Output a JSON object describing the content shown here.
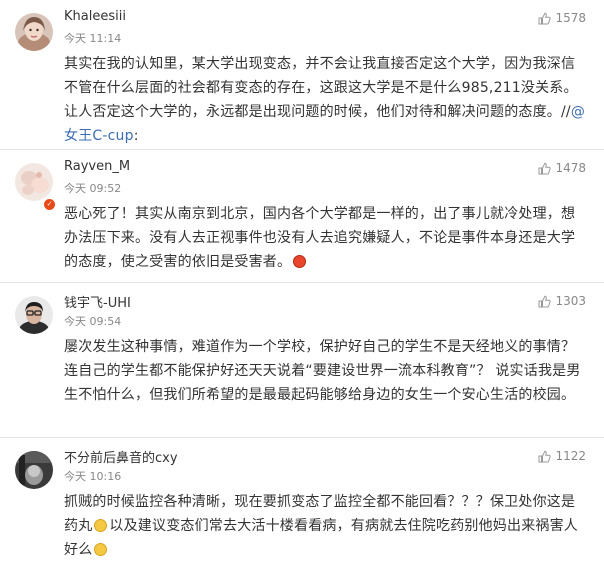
{
  "icons": {
    "like": "thumbs-up-icon",
    "smile": "smile-emoji-icon",
    "angry": "angry-emoji-icon",
    "badge": "verified-badge-icon"
  },
  "colors": {
    "mention": "#3c6cb4",
    "meta": "#888888",
    "text": "#333333",
    "divider": "#e3e3e3"
  },
  "comments": [
    {
      "username": "Khaleesiii",
      "time": "今天 11:14",
      "likes": "1578",
      "text_main": "其实在我的认知里，某大学出现变态，并不会让我直接否定这个大学，因为我深信不管在什么层面的社会都有变态的存在，这跟这大学是不是什么985,211没关系。让人否定这个大学的，永远都是出现问题的时候，他们对待和解决问题的态度。//",
      "mention": "@女王C-cup",
      "text_tail": ":"
    },
    {
      "username": "Rayven_M",
      "time": "今天 09:52",
      "likes": "1478",
      "text_main": "恶心死了！其实从南京到北京，国内各个大学都是一样的，出了事儿就冷处理，想办法压下来。没有人去正视事件也没有人去追究嫌疑人，不论是事件本身还是大学的态度，使之受害的依旧是受害者。"
    },
    {
      "username": "钱宇飞-UHI",
      "time": "今天 09:54",
      "likes": "1303",
      "text_main": "屡次发生这种事情，难道作为一个学校，保护好自己的学生不是天经地义的事情？ 连自己的学生都不能保护好还天天说着“要建设世界一流本科教育”？ 说实话我是男生不怕什么，但我们所希望的是最最起码能够给身边的女生一个安心生活的校园。"
    },
    {
      "username": "不分前后鼻音的cxy",
      "time": "今天 10:16",
      "likes": "1122",
      "text_part1": "抓贼的时候监控各种清晰，现在要抓变态了监控全都不能回看？？？保卫处你这是药丸",
      "text_part2": "以及建议变态们常去大活十楼看看病，有病就去住院吃药别他妈出来祸害人好么"
    }
  ]
}
